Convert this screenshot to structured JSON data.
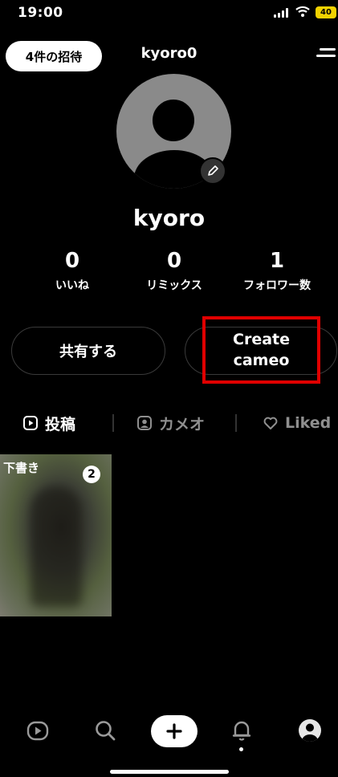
{
  "status_bar": {
    "time": "19:00",
    "battery": "40"
  },
  "header": {
    "invite_label": "4件の招待",
    "username": "kyoro0"
  },
  "profile": {
    "display_name": "kyoro"
  },
  "stats": [
    {
      "value": "0",
      "label": "いいね"
    },
    {
      "value": "0",
      "label": "リミックス"
    },
    {
      "value": "1",
      "label": "フォロワー数"
    }
  ],
  "actions": {
    "share_label": "共有する",
    "cameo_label": "Create\ncameo"
  },
  "tabs": [
    {
      "label": "投稿",
      "icon": "play-square-icon"
    },
    {
      "label": "カメオ",
      "icon": "portrait-icon"
    },
    {
      "label": "Liked",
      "icon": "heart-icon"
    }
  ],
  "drafts": {
    "label": "下書き",
    "count": "2"
  },
  "bottom_nav": [
    "feed-icon",
    "search-icon",
    "plus-icon",
    "bell-icon",
    "profile-icon"
  ],
  "colors": {
    "background": "#000000",
    "highlight": "#e00000",
    "avatar": "#8a8a8a",
    "battery": "#f2d200"
  }
}
